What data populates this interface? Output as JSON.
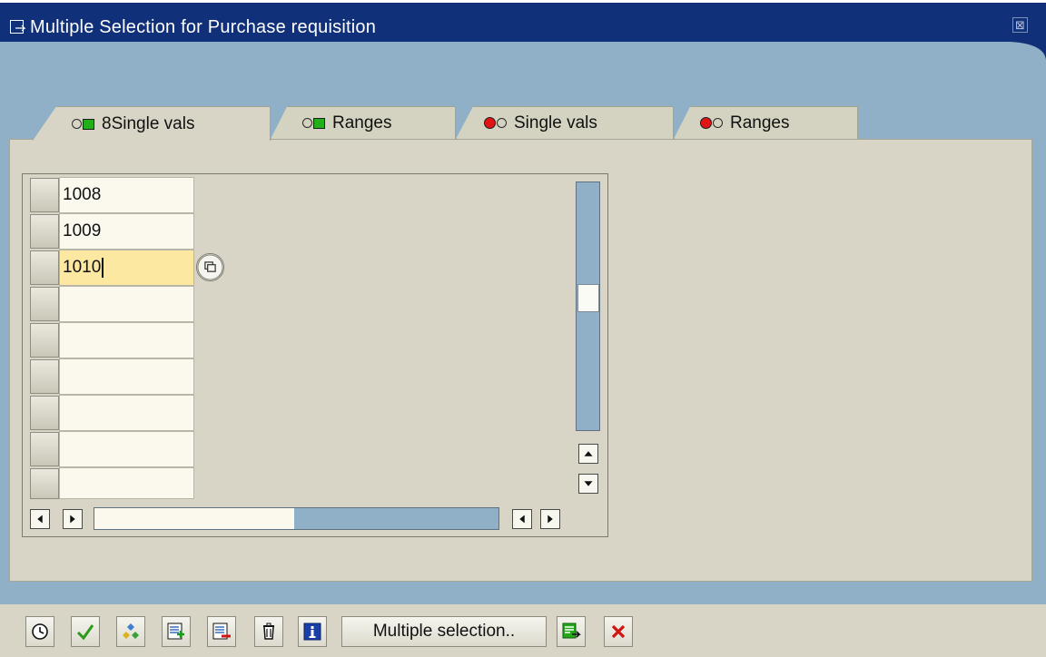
{
  "window": {
    "title": "Multiple Selection for Purchase requisition",
    "close_icon": "close-icon"
  },
  "tabs": [
    {
      "label": "8Single vals",
      "status": "include",
      "active": true
    },
    {
      "label": "Ranges",
      "status": "include",
      "active": false
    },
    {
      "label": "Single vals",
      "status": "exclude",
      "active": false
    },
    {
      "label": "Ranges",
      "status": "exclude",
      "active": false
    }
  ],
  "table": {
    "rows": [
      "1008",
      "1009",
      "1010",
      "",
      "",
      "",
      "",
      "",
      ""
    ],
    "active_row": 3
  },
  "toolbar": {
    "buttons": [
      "clock-icon",
      "checkmark-icon",
      "diamond-arrows-icon",
      "insert-line-icon",
      "delete-line-icon",
      "trash-icon",
      "info-icon"
    ],
    "multiple_selection_label": "Multiple selection..",
    "extra_buttons": [
      "copy-icon",
      "cancel-icon"
    ]
  },
  "colors": {
    "titlebar": "#10307a",
    "window_bg": "#8fb0c6",
    "panel_bg": "#d8d5c6",
    "active_cell": "#fde8a2",
    "include_led": "#22b01a",
    "exclude_led": "#e01414"
  }
}
